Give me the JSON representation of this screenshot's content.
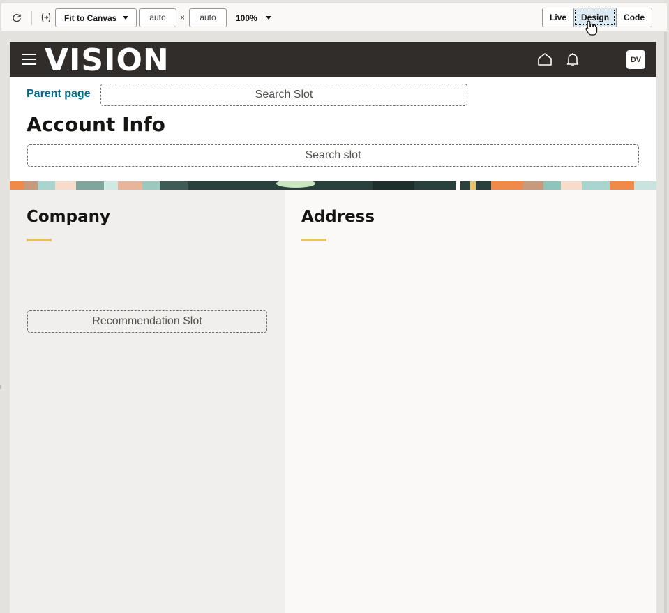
{
  "toolbar": {
    "refresh_icon": "refresh-icon",
    "bind_icon": "expression-icon",
    "fit_label": "Fit to Canvas",
    "width_value": "auto",
    "times": "×",
    "height_value": "auto",
    "zoom_label": "100%",
    "modes": [
      "Live",
      "Design",
      "Code"
    ],
    "active_mode": "Design"
  },
  "app": {
    "logo": "VISION",
    "avatar_initials": "DV",
    "parent_link": "Parent page",
    "top_search_slot": "Search Slot",
    "title": "Account Info",
    "search_slot": "Search slot"
  },
  "sections": {
    "company_title": "Company",
    "recommendation_slot": "Recommendation Slot",
    "address_title": "Address"
  },
  "colors": {
    "appbar": "#312d2a",
    "link": "#006b8f",
    "accent": "#e8c26b",
    "selected_mode": "#dbe9f3"
  }
}
